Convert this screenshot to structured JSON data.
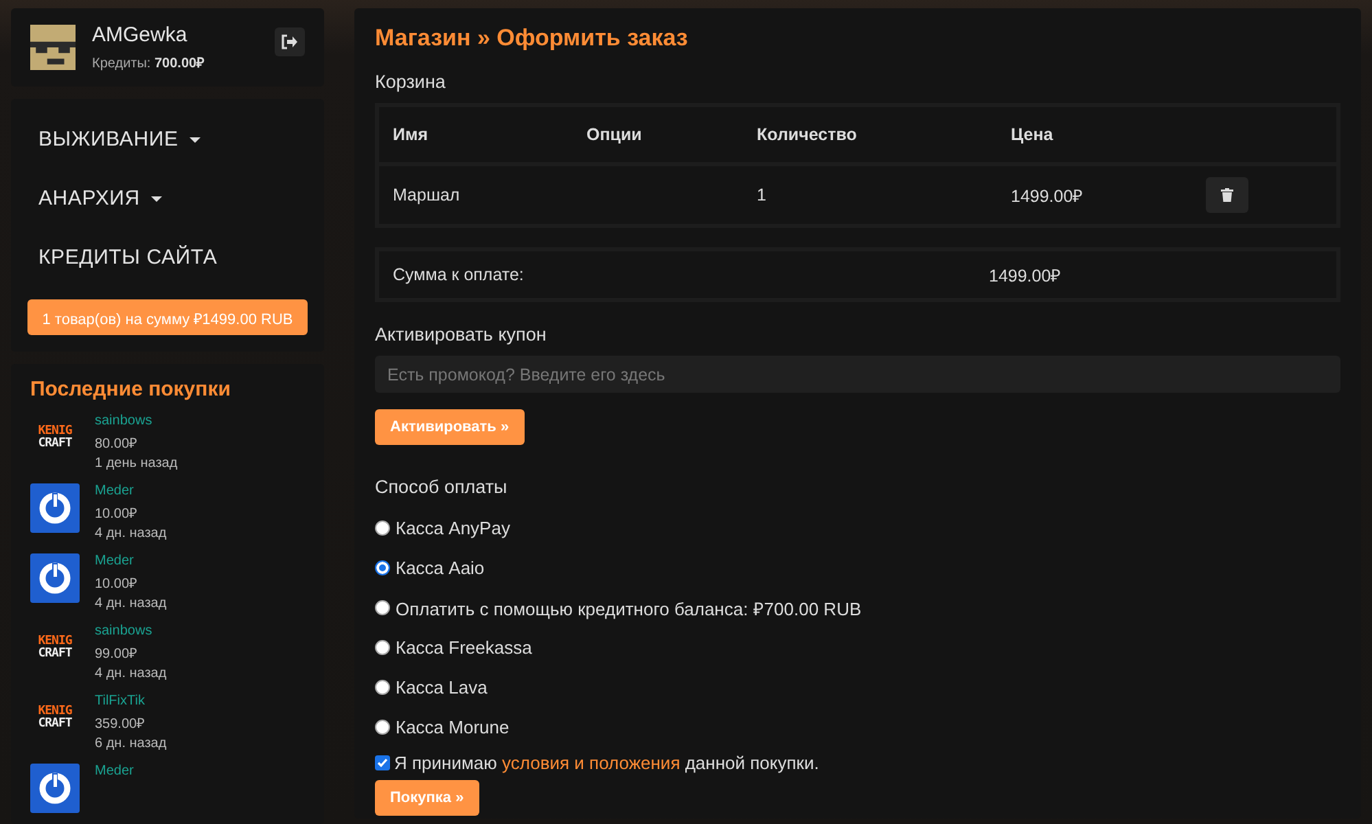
{
  "user": {
    "name": "AMGewka",
    "credits_label": "Кредиты:",
    "credits_value": "700.00₽"
  },
  "nav": {
    "items": [
      {
        "label": "ВЫЖИВАНИЕ",
        "dropdown": true
      },
      {
        "label": "АНАРХИЯ",
        "dropdown": true
      },
      {
        "label": "КРЕДИТЫ САЙТА",
        "dropdown": false
      }
    ],
    "cart_button": "1 товар(ов) на сумму ₽1499.00 RUB"
  },
  "purchases": {
    "title": "Последние покупки",
    "items": [
      {
        "kind": "kenig",
        "logo": [
          "KENIG",
          "CRAFT"
        ],
        "name": "sainbows",
        "price": "80.00₽",
        "time": "1 день назад"
      },
      {
        "kind": "power",
        "name": "Meder",
        "price": "10.00₽",
        "time": "4 дн. назад"
      },
      {
        "kind": "power",
        "name": "Meder",
        "price": "10.00₽",
        "time": "4 дн. назад"
      },
      {
        "kind": "kenig",
        "logo": [
          "KENIG",
          "CRAFT"
        ],
        "name": "sainbows",
        "price": "99.00₽",
        "time": "4 дн. назад"
      },
      {
        "kind": "kenig",
        "logo": [
          "KENIG",
          "CRAFT"
        ],
        "name": "TilFixTik",
        "price": "359.00₽",
        "time": "6 дн. назад"
      },
      {
        "kind": "power",
        "name": "Meder"
      }
    ]
  },
  "checkout": {
    "breadcrumb": "Магазин » Оформить заказ",
    "cart_title": "Корзина",
    "table": {
      "columns": [
        "Имя",
        "Опции",
        "Количество",
        "Цена"
      ],
      "rows": [
        [
          "Маршал",
          "",
          "1",
          "1499.00₽"
        ]
      ]
    },
    "total": {
      "label": "Сумма к оплате:",
      "value": "1499.00₽"
    },
    "coupon": {
      "title": "Активировать купон",
      "placeholder": "Есть промокод? Введите его здесь",
      "button": "Активировать »"
    },
    "payment": {
      "title": "Способ оплаты",
      "methods": [
        {
          "label": "Касса AnyPay",
          "selected": false
        },
        {
          "label": "Касса Aaio",
          "selected": true
        },
        {
          "label": "Оплатить с помощью кредитного баланса: ₽700.00 RUB",
          "selected": false
        },
        {
          "label": "Касса Freekassa",
          "selected": false
        },
        {
          "label": "Касса Lava",
          "selected": false
        },
        {
          "label": "Касса Morune",
          "selected": false
        }
      ]
    },
    "terms": {
      "checked": true,
      "before": "Я принимаю ",
      "link": "условия и положения",
      "after": " данной покупки."
    },
    "purchase_button": "Покупка »"
  }
}
